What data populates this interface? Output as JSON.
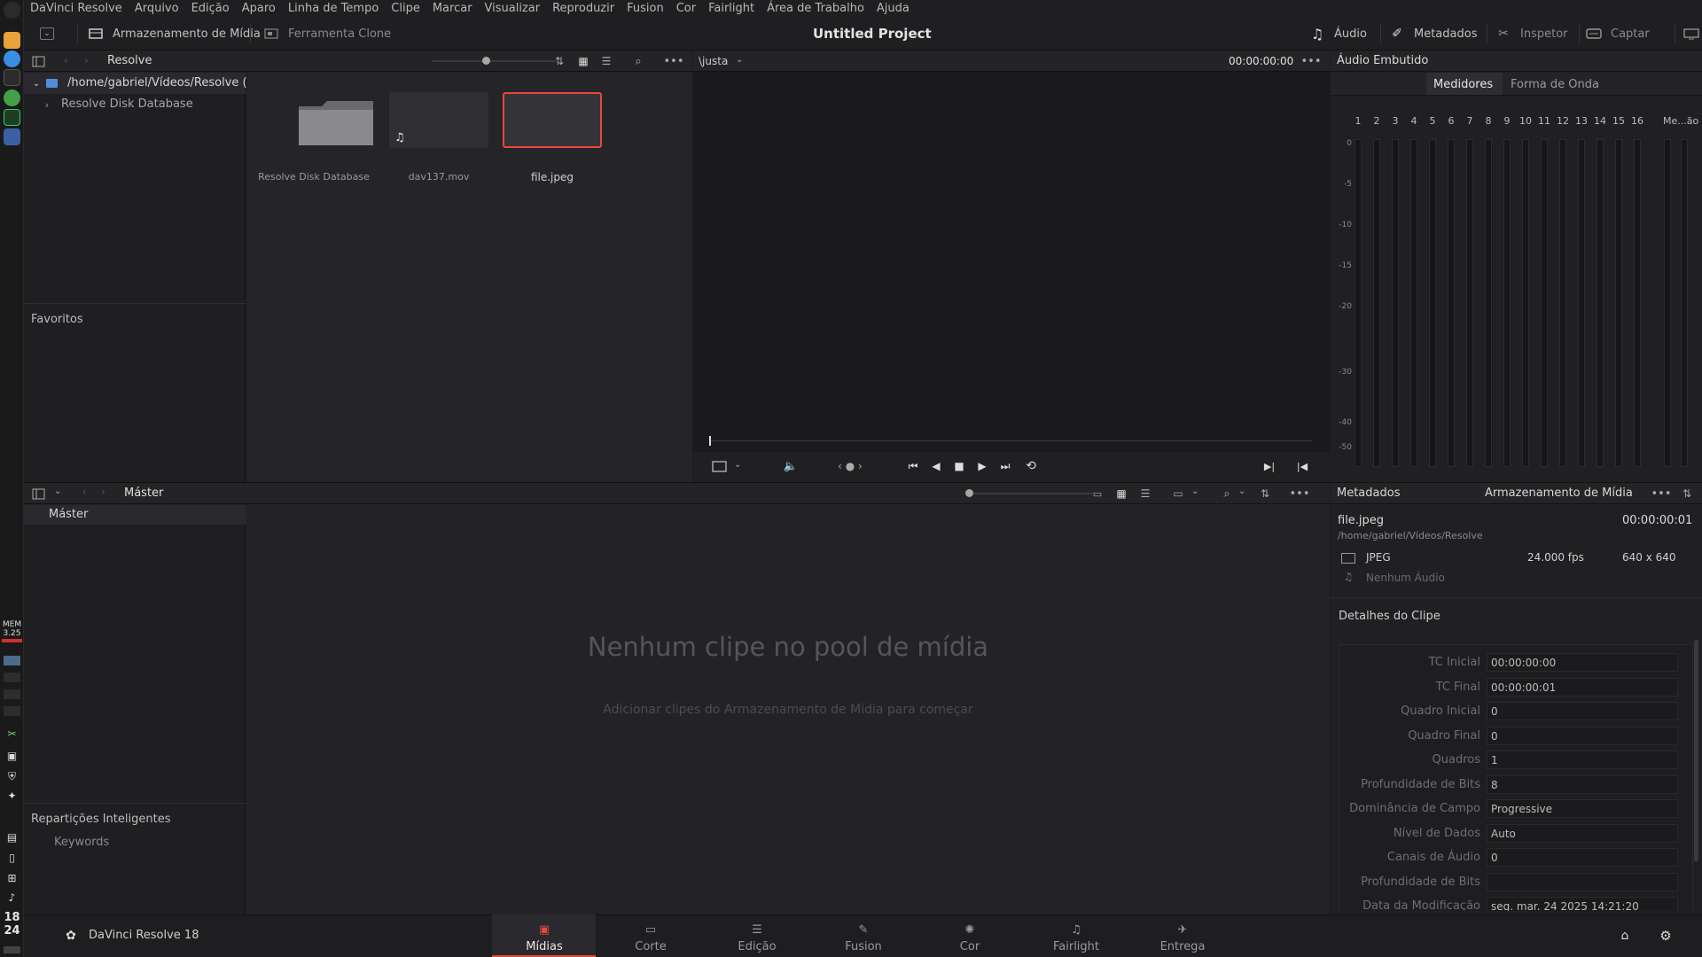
{
  "menubar": {
    "app_name": "DaVinci Resolve",
    "items": [
      "Arquivo",
      "Edição",
      "Aparo",
      "Linha de Tempo",
      "Clipe",
      "Marcar",
      "Visualizar",
      "Reproduzir",
      "Fusion",
      "Cor",
      "Fairlight",
      "Área de Trabalho",
      "Ajuda"
    ]
  },
  "toolbar": {
    "media_storage": "Armazenamento de Mídia",
    "clone_tool": "Ferramenta Clone",
    "project_title": "Untitled Project",
    "audio": "Áudio",
    "metadata": "Metadados",
    "inspector": "Inspetor",
    "capture": "Captar"
  },
  "media_storage": {
    "header_title": "Resolve",
    "tree_root": "/home/gabriel/Vídeos/Resolve (Us...",
    "tree_child": "Resolve Disk Database",
    "favorites": "Favoritos",
    "items": [
      {
        "name": "Resolve Disk Database",
        "kind": "folder"
      },
      {
        "name": "dav137.mov",
        "kind": "audio"
      },
      {
        "name": "file.jpeg",
        "kind": "image",
        "selected": true
      }
    ]
  },
  "viewer": {
    "zoom_label": "\\justa",
    "timecode": "00:00:00:00"
  },
  "audio_panel": {
    "title": "Áudio Embutido",
    "tab_meters": "Medidores",
    "tab_waveform": "Forma de Onda",
    "channels": [
      "1",
      "2",
      "3",
      "4",
      "5",
      "6",
      "7",
      "8",
      "9",
      "10",
      "11",
      "12",
      "13",
      "14",
      "15",
      "16"
    ],
    "master_label": "Me...ão",
    "scale": [
      "0",
      "-5",
      "-10",
      "-15",
      "-20",
      "-30",
      "-40",
      "-50"
    ]
  },
  "media_pool": {
    "header_title": "Máster",
    "bin_master": "Máster",
    "empty_title": "Nenhum clipe no pool de mídia",
    "empty_sub": "Adicionar clipes do Armazenamento de Mídia para começar",
    "smart_bins": "Repartições Inteligentes",
    "keywords": "Keywords"
  },
  "metadata": {
    "title": "Metadados",
    "source": "Armazenamento de Mídia",
    "file_name": "file.jpeg",
    "duration": "00:00:00:01",
    "path": "/home/gabriel/Vídeos/Resolve",
    "codec": "JPEG",
    "fps": "24.000 fps",
    "resolution": "640 x 640",
    "no_audio": "Nenhum Áudio",
    "section": "Detalhes do Clipe",
    "fields": [
      {
        "label": "TC Inicial",
        "value": "00:00:00:00"
      },
      {
        "label": "TC Final",
        "value": "00:00:00:01"
      },
      {
        "label": "Quadro Inicial",
        "value": "0"
      },
      {
        "label": "Quadro Final",
        "value": "0"
      },
      {
        "label": "Quadros",
        "value": "1"
      },
      {
        "label": "Profundidade de Bits",
        "value": "8"
      },
      {
        "label": "Dominância de Campo",
        "value": "Progressive"
      },
      {
        "label": "Nível de Dados",
        "value": "Auto"
      },
      {
        "label": "Canais de Áudio",
        "value": "0"
      },
      {
        "label": "Profundidade de Bits",
        "value": ""
      },
      {
        "label": "Data da Modificação",
        "value": "seg. mar. 24 2025 14:21:20"
      }
    ]
  },
  "bottom": {
    "brand": "DaVinci Resolve 18",
    "pages": [
      "Mídias",
      "Corte",
      "Edição",
      "Fusion",
      "Cor",
      "Fairlight",
      "Entrega"
    ],
    "active_page": "Mídias"
  },
  "dock": {
    "mem_label": "MEM",
    "mem_value": "3.25",
    "clock_h": "18",
    "clock_m": "24"
  },
  "colors": {
    "accent_red": "#e8473c",
    "bg": "#1c1c1e",
    "panel": "#202023"
  }
}
